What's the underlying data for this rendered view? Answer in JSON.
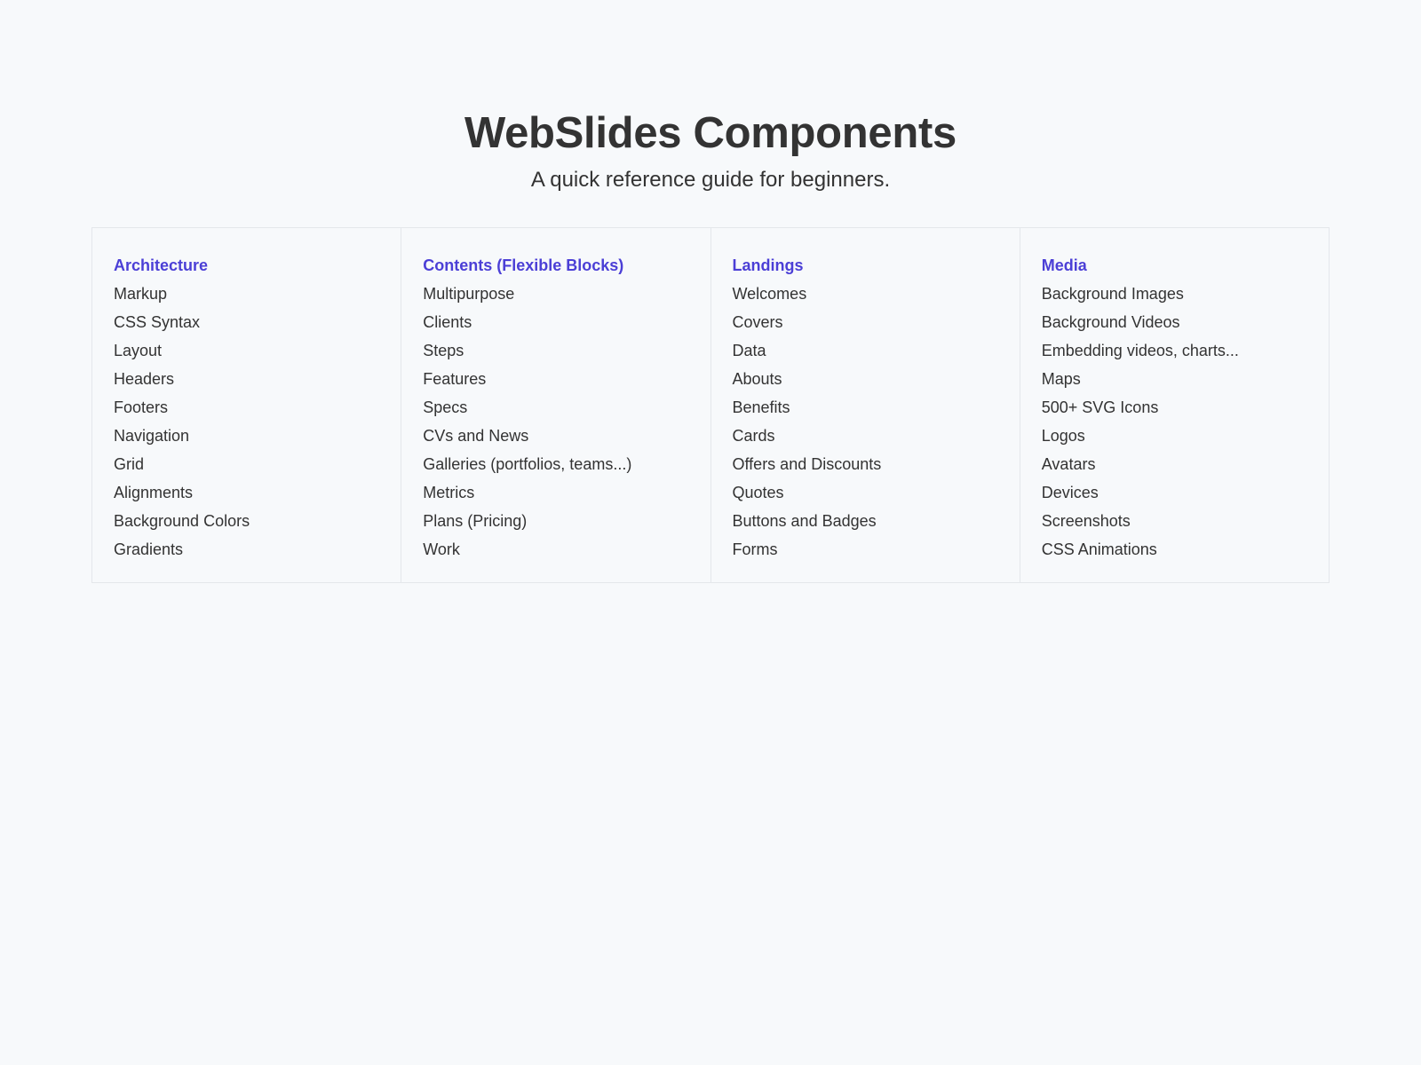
{
  "header": {
    "title": "WebSlides Components",
    "subtitle": "A quick reference guide for beginners."
  },
  "colors": {
    "background": "#f7f9fb",
    "text": "#333333",
    "accent": "#4b3fd6",
    "border": "#e4e7eb"
  },
  "columns": [
    {
      "heading": "Architecture",
      "items": [
        "Markup",
        "CSS Syntax",
        "Layout",
        "Headers",
        "Footers",
        "Navigation",
        "Grid",
        "Alignments",
        "Background Colors",
        "Gradients"
      ]
    },
    {
      "heading": "Contents (Flexible Blocks)",
      "items": [
        "Multipurpose",
        "Clients",
        "Steps",
        "Features",
        "Specs",
        "CVs and News",
        "Galleries (portfolios, teams...)",
        "Metrics",
        "Plans (Pricing)",
        "Work"
      ]
    },
    {
      "heading": "Landings",
      "items": [
        "Welcomes",
        "Covers",
        "Data",
        "Abouts",
        "Benefits",
        "Cards",
        "Offers and Discounts",
        "Quotes",
        "Buttons and Badges",
        "Forms"
      ]
    },
    {
      "heading": "Media",
      "items": [
        "Background Images",
        "Background Videos",
        "Embedding videos, charts...",
        "Maps",
        "500+ SVG Icons",
        "Logos",
        "Avatars",
        "Devices",
        "Screenshots",
        "CSS Animations"
      ]
    }
  ]
}
